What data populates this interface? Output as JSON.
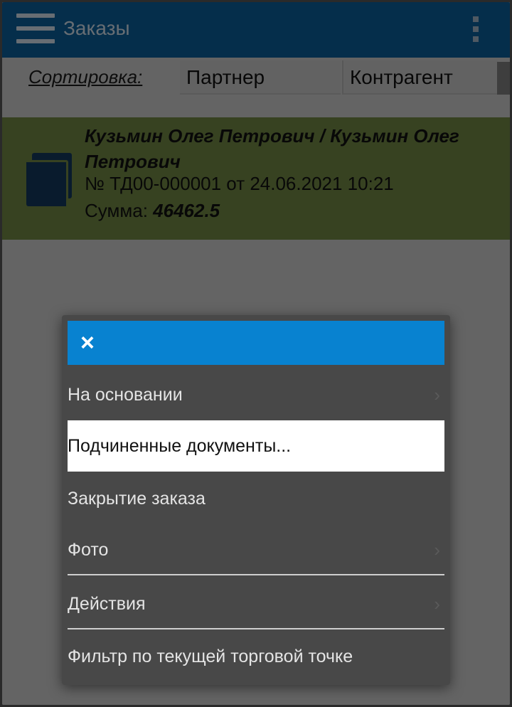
{
  "appbar": {
    "title": "Заказы"
  },
  "sort": {
    "label": "Сортировка:",
    "options": [
      "Партнер",
      "Контрагент"
    ]
  },
  "order": {
    "name": "Кузьмин Олег Петрович / Кузьмин Олег Петрович",
    "number_line": "№ ТД00-000001 от 24.06.2021 10:21",
    "sum_label": "Сумма:",
    "sum_value": "46462.5"
  },
  "menu": {
    "close_icon": "×",
    "items": [
      {
        "label": "На основании",
        "has_submenu": true
      },
      {
        "label": "Подчиненные документы...",
        "selected": true
      },
      {
        "label": "Закрытие заказа"
      },
      {
        "label": "Фото",
        "has_submenu": true
      },
      {
        "label": "Действия",
        "has_submenu": true
      },
      {
        "label": "Фильтр по текущей торговой точке"
      }
    ],
    "chevron": "›"
  },
  "colors": {
    "appbar": "#0a5d97",
    "order_card": "#6e8442",
    "menu_header": "#0882d0",
    "menu_bg": "#484848"
  }
}
